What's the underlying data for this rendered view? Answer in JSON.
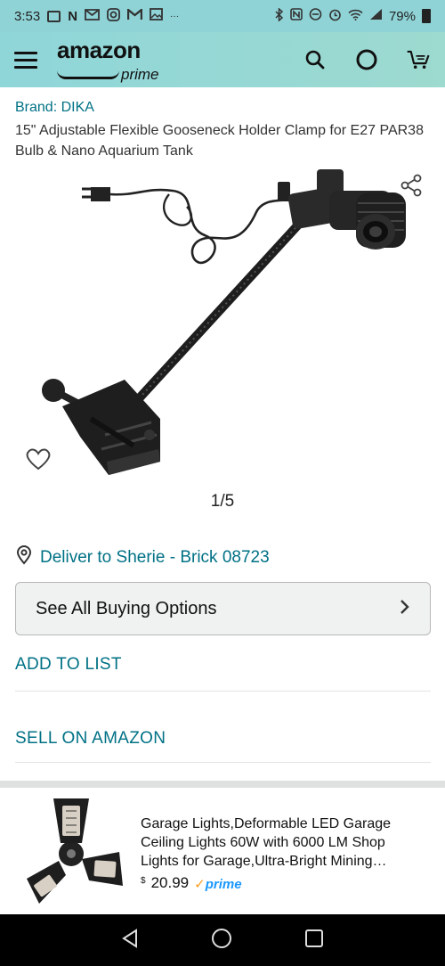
{
  "status_bar": {
    "time": "3:53",
    "left_icons": [
      "notification-icon",
      "n-icon",
      "gmail-icon",
      "instagram-icon",
      "gmail-icon",
      "gallery-icon",
      "more-dots-icon"
    ],
    "more": "···",
    "right_icons": [
      "bluetooth-icon",
      "nfc-icon",
      "link-icon",
      "alarm-icon",
      "wifi-icon",
      "signal-icon",
      "battery-icon"
    ],
    "battery": "79%"
  },
  "header": {
    "logo_amazon": "amazon",
    "logo_prime": "prime",
    "icons": [
      "menu-icon",
      "search-icon",
      "alexa-icon",
      "cart-icon"
    ],
    "background": "#8fd6d9"
  },
  "product": {
    "brand": "Brand: DIKA",
    "title": "15\" Adjustable Flexible Gooseneck Holder Clamp for E27 PAR38 Bulb & Nano Aquarium Tank",
    "image_counter": "1/5"
  },
  "delivery": {
    "text": "Deliver to Sherie - Brick 08723"
  },
  "actions": {
    "buying_options": "See All Buying Options",
    "add_to_list": "ADD TO LIST",
    "sell_on_amazon": "SELL ON AMAZON"
  },
  "ad": {
    "title": "Garage Lights,Deformable LED Garage Ceiling Lights 60W with 6000 LM Shop Lights for Garage,Ultra-Bright Mining…",
    "price_symbol": "$",
    "price": "20.99",
    "prime_badge": "prime"
  },
  "colors": {
    "link": "#007185",
    "prime_blue": "#1a98ff"
  }
}
